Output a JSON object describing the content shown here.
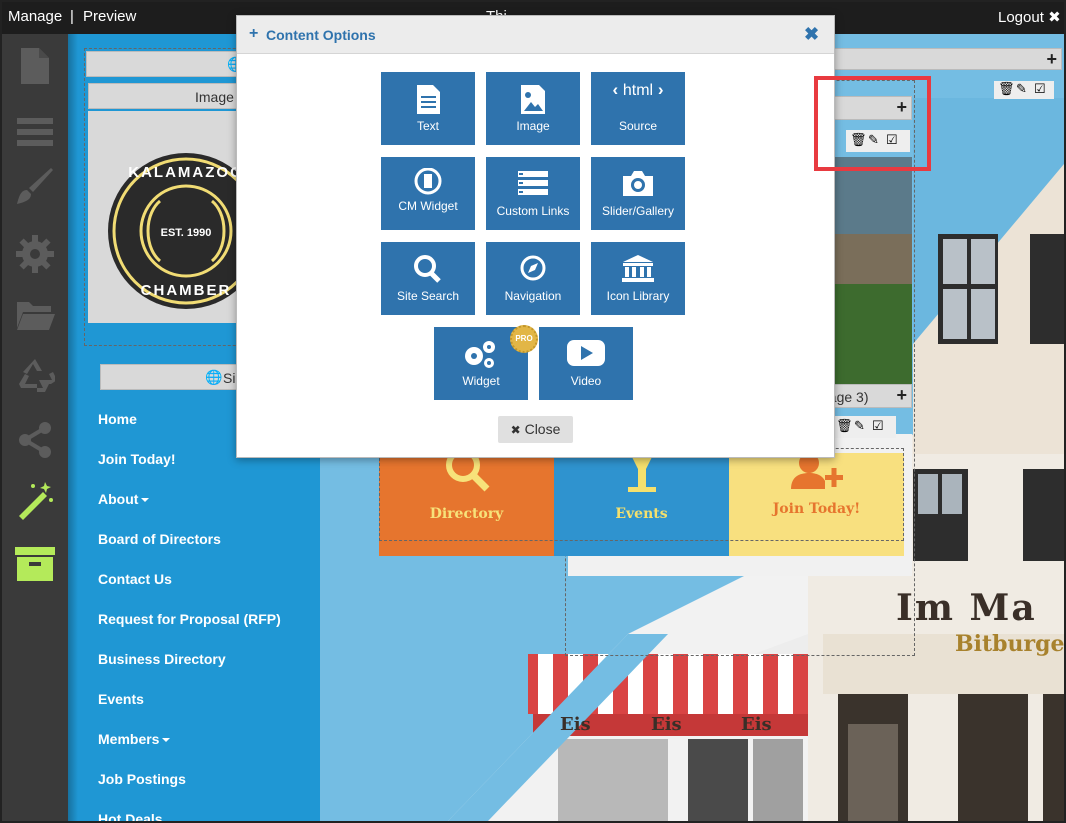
{
  "topbar": {
    "manage": "Manage",
    "separator": "|",
    "preview": "Preview",
    "center_text": "Thi",
    "logout": "Logout"
  },
  "sidebar_icons": [
    "page-icon",
    "menu-icon",
    "brush-icon",
    "gear-icon",
    "folder-icon",
    "recycle-icon",
    "share-icon",
    "magic-wand-icon",
    "archive-icon"
  ],
  "site": {
    "image_label": "Image",
    "logo": {
      "top_text": "KALAMAZOO",
      "est": "EST. 1990",
      "bottom_text": "CHAMBER"
    },
    "site_bar_label": "Si",
    "nav": [
      {
        "label": "Home"
      },
      {
        "label": "Join Today!"
      },
      {
        "label": "About",
        "dropdown": true
      },
      {
        "label": "Board of Directors"
      },
      {
        "label": "Contact Us"
      },
      {
        "label": "Request for Proposal (RFP)"
      },
      {
        "label": "Business Directory"
      },
      {
        "label": "Events"
      },
      {
        "label": "Members",
        "dropdown": true
      },
      {
        "label": "Job Postings"
      },
      {
        "label": "Hot Deals"
      }
    ],
    "image3_label": "nage 3)",
    "tiles": [
      {
        "label": "Directory",
        "color": "#e6752e",
        "text_color": "#f7e27a"
      },
      {
        "label": "Events",
        "color": "#2f93cf",
        "text_color": "#f5e06d"
      },
      {
        "label": "Join Today!",
        "color": "#f8e07f",
        "text_color": "#e6752e"
      }
    ],
    "storefront": {
      "sign": "Im Ma",
      "brand": "Bitburger",
      "awning": [
        "Eis",
        "Eis",
        "Eis"
      ]
    }
  },
  "modal": {
    "title": "Content Options",
    "options": [
      {
        "label": "Text",
        "icon": "text-icon"
      },
      {
        "label": "Image",
        "icon": "image-icon"
      },
      {
        "label": "Source",
        "icon": "html-icon",
        "icon_text": "html",
        "highlighted": true
      },
      {
        "label": "CM Widget",
        "icon": "cm-widget-icon"
      },
      {
        "label": "Custom Links",
        "icon": "custom-links-icon"
      },
      {
        "label": "Slider/Gallery",
        "icon": "camera-icon"
      },
      {
        "label": "Site Search",
        "icon": "search-icon"
      },
      {
        "label": "Navigation",
        "icon": "compass-icon"
      },
      {
        "label": "Icon Library",
        "icon": "bank-icon"
      },
      {
        "label": "Widget",
        "icon": "gears-icon",
        "badge": "PRO"
      },
      {
        "label": "Video",
        "icon": "youtube-icon"
      }
    ],
    "close_label": "Close"
  },
  "colors": {
    "accent": "#2f73ad",
    "highlight": "#e83a40",
    "nav_bg": "#1f97d4",
    "wand": "#b4ea5a"
  }
}
